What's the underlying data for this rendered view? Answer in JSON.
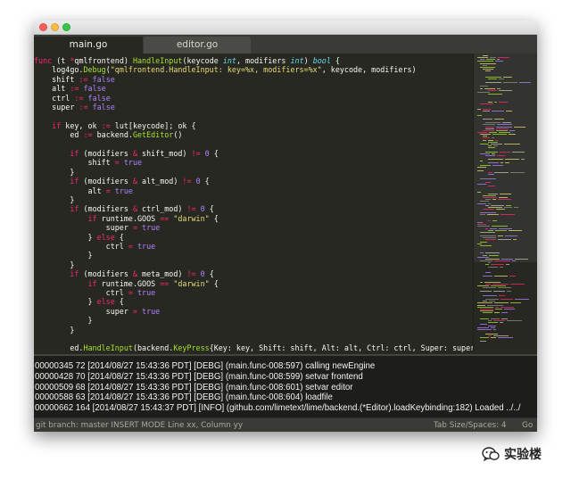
{
  "tabs": [
    {
      "label": "main.go"
    },
    {
      "label": "editor.go"
    }
  ],
  "code_lines": [
    [
      [
        "t-kw",
        "func "
      ],
      [
        "t-text",
        "(t "
      ],
      [
        "t-kw",
        "*"
      ],
      [
        "t-text",
        "qmlfrontend) "
      ],
      [
        "t-fn",
        "HandleInput"
      ],
      [
        "t-text",
        "(keycode "
      ],
      [
        "t-type",
        "int"
      ],
      [
        "t-text",
        ", modifiers "
      ],
      [
        "t-type",
        "int"
      ],
      [
        "t-text",
        ") "
      ],
      [
        "t-type",
        "bool"
      ],
      [
        "t-text",
        " {"
      ]
    ],
    [
      [
        "t-text",
        "    log4go."
      ],
      [
        "t-fn",
        "Debug"
      ],
      [
        "t-text",
        "("
      ],
      [
        "t-str",
        "\"qmlfrontend.HandleInput: key=%x, modifiers=%x\""
      ],
      [
        "t-text",
        ", keycode, modifiers)"
      ]
    ],
    [
      [
        "t-text",
        "    shift "
      ],
      [
        "t-kw",
        ":="
      ],
      [
        "t-text",
        " "
      ],
      [
        "t-num",
        "false"
      ]
    ],
    [
      [
        "t-text",
        "    alt "
      ],
      [
        "t-kw",
        ":="
      ],
      [
        "t-text",
        " "
      ],
      [
        "t-num",
        "false"
      ]
    ],
    [
      [
        "t-text",
        "    ctrl "
      ],
      [
        "t-kw",
        ":="
      ],
      [
        "t-text",
        " "
      ],
      [
        "t-num",
        "false"
      ]
    ],
    [
      [
        "t-text",
        "    super "
      ],
      [
        "t-kw",
        ":="
      ],
      [
        "t-text",
        " "
      ],
      [
        "t-num",
        "false"
      ]
    ],
    [],
    [
      [
        "t-text",
        "    "
      ],
      [
        "t-kw",
        "if"
      ],
      [
        "t-text",
        " key, ok "
      ],
      [
        "t-kw",
        ":="
      ],
      [
        "t-text",
        " lut[keycode]; ok {"
      ]
    ],
    [
      [
        "t-text",
        "        ed "
      ],
      [
        "t-kw",
        ":="
      ],
      [
        "t-text",
        " backend."
      ],
      [
        "t-fn",
        "GetEditor"
      ],
      [
        "t-text",
        "()"
      ]
    ],
    [],
    [
      [
        "t-text",
        "        "
      ],
      [
        "t-kw",
        "if"
      ],
      [
        "t-text",
        " (modifiers "
      ],
      [
        "t-kw",
        "&"
      ],
      [
        "t-text",
        " shift_mod) "
      ],
      [
        "t-kw",
        "!="
      ],
      [
        "t-text",
        " "
      ],
      [
        "t-num",
        "0"
      ],
      [
        "t-text",
        " {"
      ]
    ],
    [
      [
        "t-text",
        "            shift "
      ],
      [
        "t-kw",
        "="
      ],
      [
        "t-text",
        " "
      ],
      [
        "t-num",
        "true"
      ]
    ],
    [
      [
        "t-text",
        "        }"
      ]
    ],
    [
      [
        "t-text",
        "        "
      ],
      [
        "t-kw",
        "if"
      ],
      [
        "t-text",
        " (modifiers "
      ],
      [
        "t-kw",
        "&"
      ],
      [
        "t-text",
        " alt_mod) "
      ],
      [
        "t-kw",
        "!="
      ],
      [
        "t-text",
        " "
      ],
      [
        "t-num",
        "0"
      ],
      [
        "t-text",
        " {"
      ]
    ],
    [
      [
        "t-text",
        "            alt "
      ],
      [
        "t-kw",
        "="
      ],
      [
        "t-text",
        " "
      ],
      [
        "t-num",
        "true"
      ]
    ],
    [
      [
        "t-text",
        "        }"
      ]
    ],
    [
      [
        "t-text",
        "        "
      ],
      [
        "t-kw",
        "if"
      ],
      [
        "t-text",
        " (modifiers "
      ],
      [
        "t-kw",
        "&"
      ],
      [
        "t-text",
        " ctrl_mod) "
      ],
      [
        "t-kw",
        "!="
      ],
      [
        "t-text",
        " "
      ],
      [
        "t-num",
        "0"
      ],
      [
        "t-text",
        " {"
      ]
    ],
    [
      [
        "t-text",
        "            "
      ],
      [
        "t-kw",
        "if"
      ],
      [
        "t-text",
        " runtime.GOOS "
      ],
      [
        "t-kw",
        "=="
      ],
      [
        "t-text",
        " "
      ],
      [
        "t-str",
        "\"darwin\""
      ],
      [
        "t-text",
        " {"
      ]
    ],
    [
      [
        "t-text",
        "                super "
      ],
      [
        "t-kw",
        "="
      ],
      [
        "t-text",
        " "
      ],
      [
        "t-num",
        "true"
      ]
    ],
    [
      [
        "t-text",
        "            } "
      ],
      [
        "t-kw",
        "else"
      ],
      [
        "t-text",
        " {"
      ]
    ],
    [
      [
        "t-text",
        "                ctrl "
      ],
      [
        "t-kw",
        "="
      ],
      [
        "t-text",
        " "
      ],
      [
        "t-num",
        "true"
      ]
    ],
    [
      [
        "t-text",
        "            }"
      ]
    ],
    [
      [
        "t-text",
        "        }"
      ]
    ],
    [
      [
        "t-text",
        "        "
      ],
      [
        "t-kw",
        "if"
      ],
      [
        "t-text",
        " (modifiers "
      ],
      [
        "t-kw",
        "&"
      ],
      [
        "t-text",
        " meta_mod) "
      ],
      [
        "t-kw",
        "!="
      ],
      [
        "t-text",
        " "
      ],
      [
        "t-num",
        "0"
      ],
      [
        "t-text",
        " {"
      ]
    ],
    [
      [
        "t-text",
        "            "
      ],
      [
        "t-kw",
        "if"
      ],
      [
        "t-text",
        " runtime.GOOS "
      ],
      [
        "t-kw",
        "=="
      ],
      [
        "t-text",
        " "
      ],
      [
        "t-str",
        "\"darwin\""
      ],
      [
        "t-text",
        " {"
      ]
    ],
    [
      [
        "t-text",
        "                ctrl "
      ],
      [
        "t-kw",
        "="
      ],
      [
        "t-text",
        " "
      ],
      [
        "t-num",
        "true"
      ]
    ],
    [
      [
        "t-text",
        "            } "
      ],
      [
        "t-kw",
        "else"
      ],
      [
        "t-text",
        " {"
      ]
    ],
    [
      [
        "t-text",
        "                super "
      ],
      [
        "t-kw",
        "="
      ],
      [
        "t-text",
        " "
      ],
      [
        "t-num",
        "true"
      ]
    ],
    [
      [
        "t-text",
        "            }"
      ]
    ],
    [
      [
        "t-text",
        "        }"
      ]
    ],
    [],
    [
      [
        "t-text",
        "        ed."
      ],
      [
        "t-fn",
        "HandleInput"
      ],
      [
        "t-text",
        "(backend."
      ],
      [
        "t-fn",
        "KeyPress"
      ],
      [
        "t-text",
        "{Key: key, Shift: shift, Alt: alt, Ctrl: ctrl, Super: super})"
      ]
    ],
    [
      [
        "t-text",
        "        "
      ],
      [
        "t-kw",
        "return"
      ],
      [
        "t-text",
        " "
      ],
      [
        "t-num",
        "true"
      ]
    ]
  ],
  "console_lines": [
    "00000345 72 [2014/08/27 15:43:36 PDT] [DEBG] (main.func-008:597) calling newEngine",
    "00000428 70 [2014/08/27 15:43:36 PDT] [DEBG] (main.func-008:599) setvar frontend",
    "00000509 68 [2014/08/27 15:43:36 PDT] [DEBG] (main.func-008:601) setvar editor",
    "00000588 63 [2014/08/27 15:43:36 PDT] [DEBG] (main.func-008:604) loadfile",
    "00000662 164 [2014/08/27 15:43:37 PDT] [INFO] (github.com/limetext/lime/backend.(*Editor).loadKeybinding:182) Loaded ../../"
  ],
  "status": {
    "left": "git branch: master INSERT MODE Line xx, Column yy",
    "tab_size": "Tab Size/Spaces: 4",
    "language": "Go"
  },
  "watermark": {
    "text": "实验楼",
    "icon": "wechat-icon"
  },
  "colors": {
    "background": "#272822",
    "keyword": "#f92672",
    "function": "#a6e22e",
    "string": "#e6db74",
    "number": "#ae81ff",
    "type": "#66d9ef",
    "text": "#f8f8f2"
  }
}
